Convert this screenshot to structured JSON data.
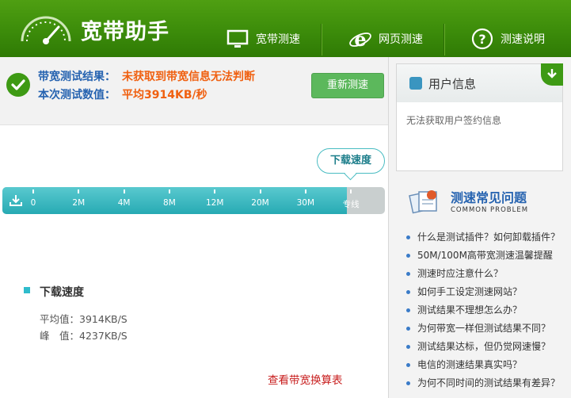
{
  "app": {
    "title": "宽带助手"
  },
  "nav": [
    {
      "label": "宽带测速",
      "icon": "monitor-icon"
    },
    {
      "label": "网页测速",
      "icon": "ie-browser-icon"
    },
    {
      "label": "测速说明",
      "icon": "help-question-icon"
    }
  ],
  "result": {
    "label1": "带宽测试结果：",
    "value1": "未获取到带宽信息无法判断",
    "label2": "本次测试数值：",
    "value2": "平均3914KB/秒",
    "retest": "重新测速"
  },
  "gauge": {
    "bubble": "下载速度",
    "ticks": [
      "0",
      "2M",
      "4M",
      "8M",
      "12M",
      "20M",
      "30M",
      "专线"
    ],
    "fill_fraction": 0.9
  },
  "detail": {
    "title": "下载速度",
    "avg_label": "平均值：",
    "avg_value": "3914KB/S",
    "peak_label": "峰　值：",
    "peak_value": "4237KB/S"
  },
  "link": {
    "table": "查看带宽换算表"
  },
  "user_info": {
    "title": "用户信息",
    "message": "无法获取用户签约信息"
  },
  "faq": {
    "title": "测速常见问题",
    "subtitle": "COMMON PROBLEM",
    "items": [
      "什么是测试插件？如何卸载插件？",
      "50M/100M高带宽测速温馨提醒",
      "测速时应注意什么？",
      "如何手工设定测速网站？",
      "测试结果不理想怎么办？",
      "为何带宽一样但测试结果不同？",
      "测试结果达标，但仍觉网速慢？",
      "电信的测速结果真实吗？",
      "为何不同时间的测试结果有差异？"
    ]
  },
  "colors": {
    "header": "#3c8c0a",
    "accent_blue": "#2663b0",
    "accent_orange": "#f06010",
    "gauge_fill": "#27aab3",
    "link_red": "#c81e1e"
  }
}
